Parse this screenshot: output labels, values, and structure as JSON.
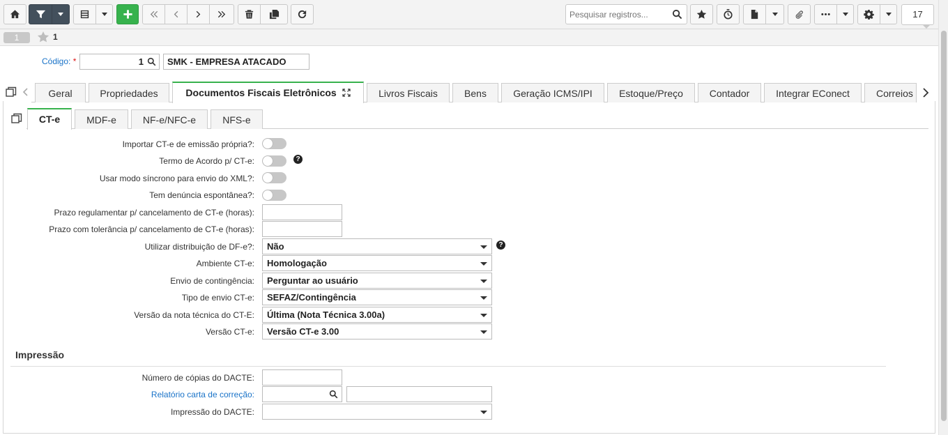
{
  "toolbar": {
    "home_icon": "home-icon",
    "filter_icon": "filter-icon",
    "grid_icon": "grid-icon",
    "add_icon": "plus-icon",
    "first_icon": "double-chevron-left-icon",
    "prev_icon": "chevron-left-icon",
    "next_icon": "chevron-right-icon",
    "last_icon": "double-chevron-right-icon",
    "delete_icon": "trash-icon",
    "copy_icon": "copy-icon",
    "refresh_icon": "refresh-icon",
    "search_placeholder": "Pesquisar registros...",
    "favorite_icon": "star-icon",
    "timer_icon": "stopwatch-icon",
    "report_icon": "file-icon",
    "attach_icon": "paperclip-icon",
    "more_icon": "ellipsis-icon",
    "settings_icon": "gear-icon",
    "page_count": "17"
  },
  "record_bar": {
    "record_index": "1",
    "favorites_count": "1"
  },
  "header": {
    "codigo_label": "Código:",
    "codigo_required": "*",
    "codigo_value": "1",
    "empresa_name": "SMK - EMPRESA ATACADO"
  },
  "tabs": [
    {
      "label": "Geral",
      "active": false
    },
    {
      "label": "Propriedades",
      "active": false
    },
    {
      "label": "Documentos Fiscais Eletrônicos",
      "active": true
    },
    {
      "label": "Livros Fiscais",
      "active": false
    },
    {
      "label": "Bens",
      "active": false
    },
    {
      "label": "Geração ICMS/IPI",
      "active": false
    },
    {
      "label": "Estoque/Preço",
      "active": false
    },
    {
      "label": "Contador",
      "active": false
    },
    {
      "label": "Integrar EConect",
      "active": false
    },
    {
      "label": "Correios",
      "active": false
    }
  ],
  "subtabs": [
    {
      "label": "CT-e",
      "active": true
    },
    {
      "label": "MDF-e",
      "active": false
    },
    {
      "label": "NF-e/NFC-e",
      "active": false
    },
    {
      "label": "NFS-e",
      "active": false
    }
  ],
  "form": {
    "importar_label": "Importar CT-e de emissão própria?:",
    "importar_on": false,
    "termo_label": "Termo de Acordo p/ CT-e:",
    "termo_on": false,
    "sincrono_label": "Usar modo síncrono para envio do XML?:",
    "sincrono_on": false,
    "denuncia_label": "Tem denúncia espontânea?:",
    "denuncia_on": false,
    "prazo_reg_label": "Prazo regulamentar p/ cancelamento de CT-e (horas):",
    "prazo_reg_value": "",
    "prazo_tol_label": "Prazo com tolerância p/ cancelamento de CT-e (horas):",
    "prazo_tol_value": "",
    "distribuicao_label": "Utilizar distribuição de DF-e?:",
    "distribuicao_value": "Não",
    "ambiente_label": "Ambiente CT-e:",
    "ambiente_value": "Homologação",
    "contingencia_label": "Envio de contingência:",
    "contingencia_value": "Perguntar ao usuário",
    "tipo_envio_label": "Tipo de envio CT-e:",
    "tipo_envio_value": "SEFAZ/Contingência",
    "versao_nota_label": "Versão da nota técnica do CT-E:",
    "versao_nota_value": "Última (Nota Técnica 3.00a)",
    "versao_cte_label": "Versão CT-e:",
    "versao_cte_value": "Versão CT-e 3.00",
    "help_glyph": "?"
  },
  "impressao": {
    "title": "Impressão",
    "copias_label": "Número de cópias do DACTE:",
    "copias_value": "",
    "relatorio_label": "Relatório carta de correção:",
    "relatorio_code": "",
    "relatorio_desc": "",
    "impressao_label": "Impressão do DACTE:",
    "impressao_value": ""
  },
  "colors": {
    "accent": "#37b24d",
    "link": "#1a73c8",
    "toolbar_dark": "#43505c",
    "required": "#dd1111"
  }
}
